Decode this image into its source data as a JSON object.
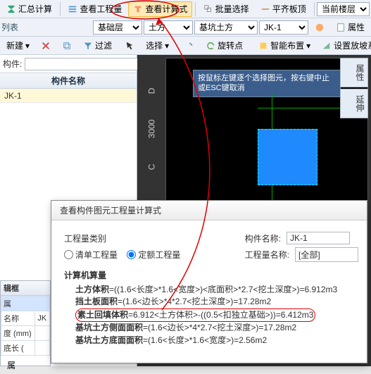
{
  "toolbar1": {
    "summary": "汇总计算",
    "view_qty": "查看工程量",
    "view_formula": "查看计算式",
    "batch_select": "批量选择",
    "flat_top": "平齐板顶",
    "current_floor": "当前楼层"
  },
  "toolbar2": {
    "list_label": "列表",
    "layer1": "基础层",
    "cat": "土方",
    "sub": "基坑土方",
    "item": "JK-1",
    "attr": "属性"
  },
  "toolbar3": {
    "new": "新建",
    "filter": "过滤",
    "select": "选择",
    "rotate_point": "旋转点",
    "smart_layout": "智能布置",
    "slope": "设置放坡系数"
  },
  "left": {
    "search_lbl": "构件:",
    "grid_header": "构件名称",
    "row1": "JK-1"
  },
  "canvas": {
    "tooltip": "按鼠标左键逐个选择图元，按右键中止或ESC键取消",
    "ruler": {
      "a": "D",
      "b": "3000",
      "c": "C"
    },
    "vtabs": {
      "a": "属性",
      "b": "延伸"
    }
  },
  "dialog": {
    "title": "查看构件图元工程量计算式",
    "cat_label": "工程量类别",
    "radio1": "清单工程量",
    "radio2": "定额工程量",
    "name_lbl": "构件名称:",
    "name_val": "JK-1",
    "qname_lbl": "工程量名称:",
    "qname_val": "[全部]",
    "calc_lbl": "计算机算量",
    "lines": {
      "l1a": "土方体积",
      "l1b": "=((1.6<长度>*1.6<宽度>)<底面积>*2.7<挖土深度>)=6.912m3",
      "l2a": "挡土板面积",
      "l2b": "=(1.6<边长>*4*2.7<挖土深度>)=17.28m2",
      "l3a": "素土回填体积",
      "l3b": "=6.912<土方体积>-((0.5<扣独立基础>))=6.412m3",
      "l4a": "基坑土方侧面面积",
      "l4b": "=(1.6<边长>*4*2.7<挖土深度>)=17.28m2",
      "l5a": "基坑土方底面面积",
      "l5b": "=(1.6<长度>*1.6<宽度>)=2.56m2"
    }
  },
  "bottom": {
    "title": "辑框",
    "r1": "属",
    "r2a": "名称",
    "r2b": "JK",
    "r3a": "度 (mm)",
    "r4a": "底长 (",
    "btn": "属"
  }
}
